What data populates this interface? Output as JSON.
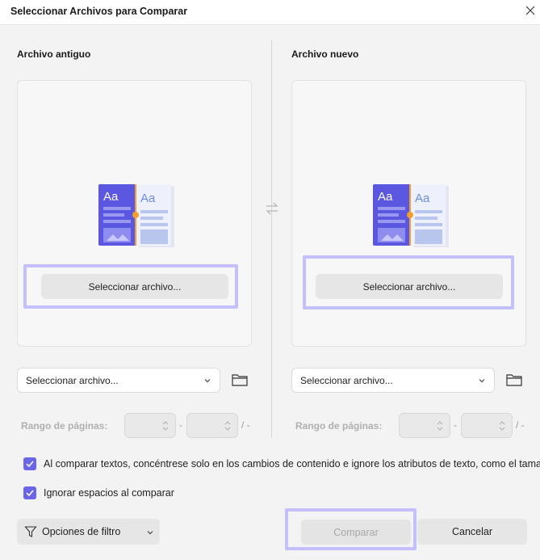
{
  "dialog": {
    "title": "Seleccionar Archivos para Comparar"
  },
  "old_file": {
    "heading": "Archivo antiguo",
    "select_button": "Seleccionar archivo...",
    "dropdown_value": "Seleccionar archivo...",
    "range_label": "Rango de páginas:",
    "range_from": "",
    "range_to": "",
    "range_sep": "-",
    "range_tail": "/ -"
  },
  "new_file": {
    "heading": "Archivo nuevo",
    "select_button": "Seleccionar archivo...",
    "dropdown_value": "Seleccionar archivo...",
    "range_label": "Rango de páginas:",
    "range_from": "",
    "range_to": "",
    "range_sep": "-",
    "range_tail": "/ -"
  },
  "illustration": {
    "left_glyph": "Aa",
    "right_glyph": "Aa"
  },
  "options": {
    "compare_text_only": {
      "label": "Al comparar textos, concéntrese solo en los cambios de contenido e ignore los atributos de texto, como el tamaño",
      "checked": true
    },
    "ignore_spaces": {
      "label": "Ignorar espacios al comparar",
      "checked": true
    }
  },
  "footer": {
    "filter_label": "Opciones de filtro",
    "compare_label": "Comparar",
    "cancel_label": "Cancelar"
  },
  "colors": {
    "accent": "#6b65e8",
    "highlight": "#c4c0ff",
    "illustration_dark": "#5b57e0",
    "illustration_light": "#dcdcf5",
    "connector": "#f0a030"
  },
  "icons": {
    "close": "close-icon",
    "swap": "swap-arrows-icon",
    "folder": "folder-icon",
    "chevron": "chevron-down-icon",
    "filter": "filter-funnel-icon",
    "check": "checkmark-icon"
  }
}
